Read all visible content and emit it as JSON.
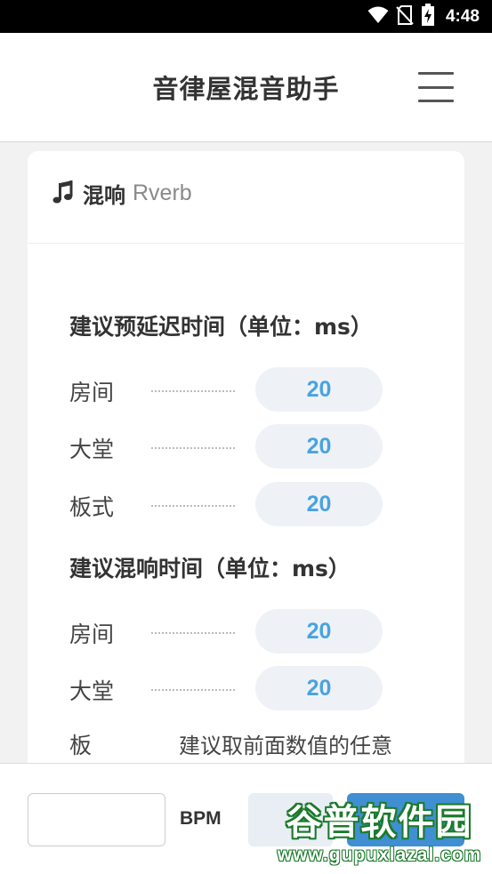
{
  "status_bar": {
    "time": "4:48",
    "icons": [
      "wifi-icon",
      "no-sim-icon",
      "battery-charging-icon"
    ]
  },
  "header": {
    "title": "音律屋混音助手",
    "menu_icon": "hamburger-menu-icon"
  },
  "card": {
    "icon": "music-note-icon",
    "title": "混响",
    "subtitle": "Rverb",
    "sections": [
      {
        "title": "建议预延迟时间（单位：ms）",
        "rows": [
          {
            "label": "房间",
            "value": "20"
          },
          {
            "label": "大堂",
            "value": "20"
          },
          {
            "label": "板式",
            "value": "20"
          }
        ]
      },
      {
        "title": "建议混响时间（单位：ms）",
        "rows": [
          {
            "label": "房间",
            "value": "20"
          },
          {
            "label": "大堂",
            "value": "20"
          }
        ],
        "partial_row": {
          "label": "板",
          "note": "建议取前面数值的任意"
        }
      }
    ]
  },
  "bottom_bar": {
    "bpm_input_value": "",
    "bpm_label": "BPM"
  },
  "watermark": {
    "text": "谷普软件园",
    "url": "www.gupuxlazal.com"
  },
  "colors": {
    "accent": "#4aa3df",
    "pill_bg": "#eef2f7",
    "button_blue": "#3f8fd2",
    "watermark_green": "#1b7a2c"
  }
}
